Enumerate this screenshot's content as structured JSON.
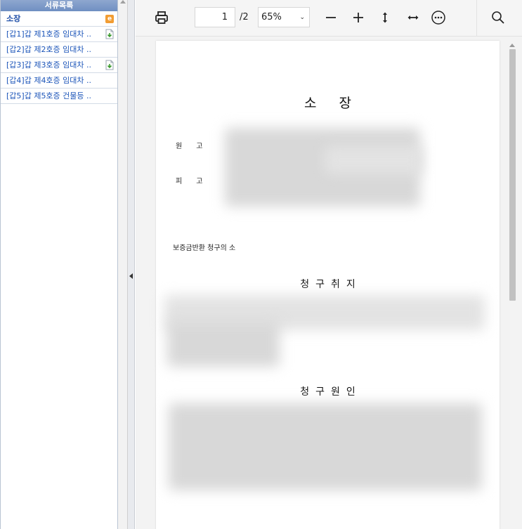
{
  "sidebar": {
    "header": "서류목록",
    "items": [
      {
        "label": "소장"
      },
      {
        "label": "[갑1]갑 제1호증 임대차 .."
      },
      {
        "label": "[갑2]갑 제2호증 임대차 .."
      },
      {
        "label": "[갑3]갑 제3호증 임대차 .."
      },
      {
        "label": "[갑4]갑 제4호증 임대차 .."
      },
      {
        "label": "[갑5]갑 제5호증 건물등 .."
      }
    ]
  },
  "toolbar": {
    "page_current": "1",
    "page_total": "/2",
    "zoom": "65%",
    "icons": [
      "print-icon",
      "zoom-out-icon",
      "zoom-in-icon",
      "fit-height-icon",
      "fit-width-icon",
      "more-icon",
      "search-icon"
    ]
  },
  "document": {
    "title": "소장",
    "plaintiff_label": "원고",
    "defendant_label": "피고",
    "claim_type": "보증금반환 청구의 소",
    "section_claim": "청구취지",
    "section_cause": "청구원인"
  },
  "colors": {
    "sidebar_header": "#7592c4",
    "link_blue": "#1c55b9",
    "toolbar_bg": "#f5f5f5",
    "viewer_bg": "#f3f3f3"
  }
}
